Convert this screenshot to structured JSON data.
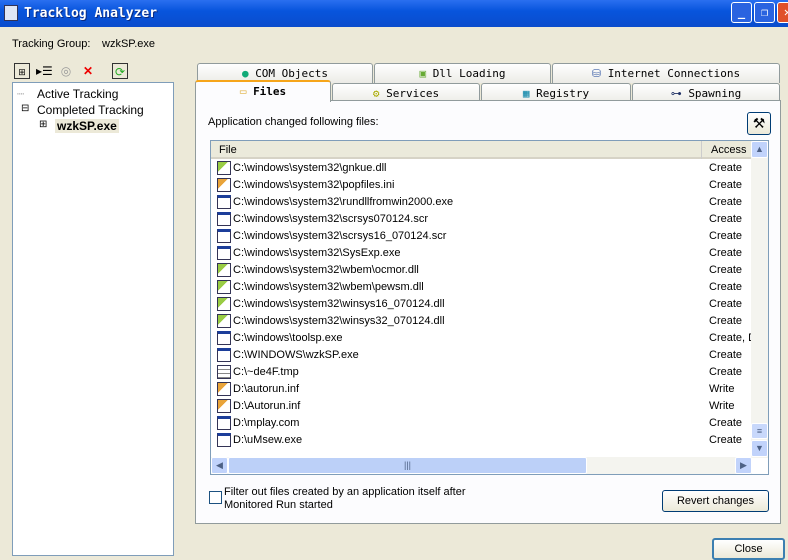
{
  "window": {
    "title": "Tracklog Analyzer"
  },
  "tracking_group": {
    "label": "Tracking Group:",
    "value": "wzkSP.exe"
  },
  "tree": {
    "items": [
      "Active Tracking",
      "Completed Tracking",
      "wzkSP.exe"
    ]
  },
  "tabs": {
    "row1": [
      "COM Objects",
      "Dll Loading",
      "Internet Connections"
    ],
    "row2": [
      "Files",
      "Services",
      "Registry",
      "Spawning"
    ]
  },
  "files": {
    "caption": "Application changed following files:",
    "columns": [
      "File",
      "Access"
    ],
    "rows": [
      {
        "file": "C:\\windows\\system32\\gnkue.dll",
        "access": "Create",
        "icon": "dll"
      },
      {
        "file": "C:\\windows\\system32\\popfiles.ini",
        "access": "Create",
        "icon": "ini"
      },
      {
        "file": "C:\\windows\\system32\\rundllfromwin2000.exe",
        "access": "Create",
        "icon": "exe"
      },
      {
        "file": "C:\\windows\\system32\\scrsys070124.scr",
        "access": "Create",
        "icon": "exe"
      },
      {
        "file": "C:\\windows\\system32\\scrsys16_070124.scr",
        "access": "Create",
        "icon": "exe"
      },
      {
        "file": "C:\\windows\\system32\\SysExp.exe",
        "access": "Create",
        "icon": "exe"
      },
      {
        "file": "C:\\windows\\system32\\wbem\\ocmor.dll",
        "access": "Create",
        "icon": "dll"
      },
      {
        "file": "C:\\windows\\system32\\wbem\\pewsm.dll",
        "access": "Create",
        "icon": "dll"
      },
      {
        "file": "C:\\windows\\system32\\winsys16_070124.dll",
        "access": "Create",
        "icon": "dll"
      },
      {
        "file": "C:\\windows\\system32\\winsys32_070124.dll",
        "access": "Create",
        "icon": "dll"
      },
      {
        "file": "C:\\windows\\toolsp.exe",
        "access": "Create, D",
        "icon": "exe"
      },
      {
        "file": "C:\\WINDOWS\\wzkSP.exe",
        "access": "Create",
        "icon": "exe"
      },
      {
        "file": "C:\\~de4F.tmp",
        "access": "Create",
        "icon": "tmp"
      },
      {
        "file": "D:\\autorun.inf",
        "access": "Write",
        "icon": "ini"
      },
      {
        "file": "D:\\Autorun.inf",
        "access": "Write",
        "icon": "ini"
      },
      {
        "file": "D:\\mplay.com",
        "access": "Create",
        "icon": "exe"
      },
      {
        "file": "D:\\uMsew.exe",
        "access": "Create",
        "icon": "exe"
      }
    ]
  },
  "filter": {
    "label_line1": "Filter out files created by an application itself after",
    "label_line2": "Monitored Run started",
    "checked": false
  },
  "buttons": {
    "revert": "Revert changes",
    "close": "Close"
  }
}
